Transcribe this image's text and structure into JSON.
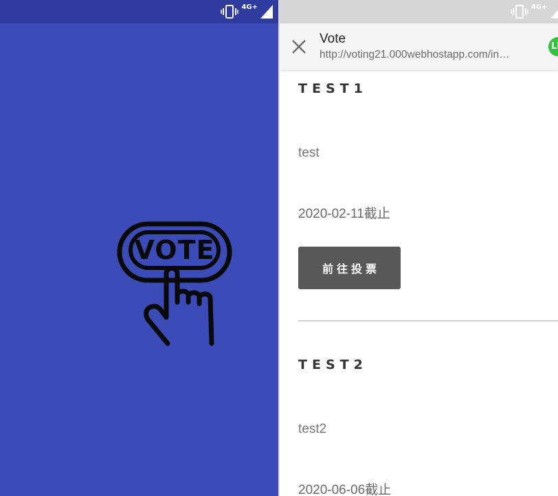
{
  "left_status_bar": {
    "network_label": "4G+",
    "icons": [
      "vibrate-icon",
      "signal-icon"
    ]
  },
  "splash": {
    "logo_text": "VOTE",
    "background_color": "#3b4cb8",
    "status_bar_color": "#2f3b9f"
  },
  "right_status_bar": {
    "network_label": "4G+",
    "icons": [
      "vibrate-icon",
      "signal-icon"
    ]
  },
  "webview": {
    "title": "Vote",
    "url": "http://voting21.000webhostapp.com/in…",
    "badge_text": "LI",
    "badge_color": "#2fc43a"
  },
  "polls": [
    {
      "title": "TEST1",
      "description": "test",
      "deadline": "2020-02-11截止",
      "button_label": "前往投票"
    },
    {
      "title": "TEST2",
      "description": "test2",
      "deadline": "2020-06-06截止"
    }
  ]
}
